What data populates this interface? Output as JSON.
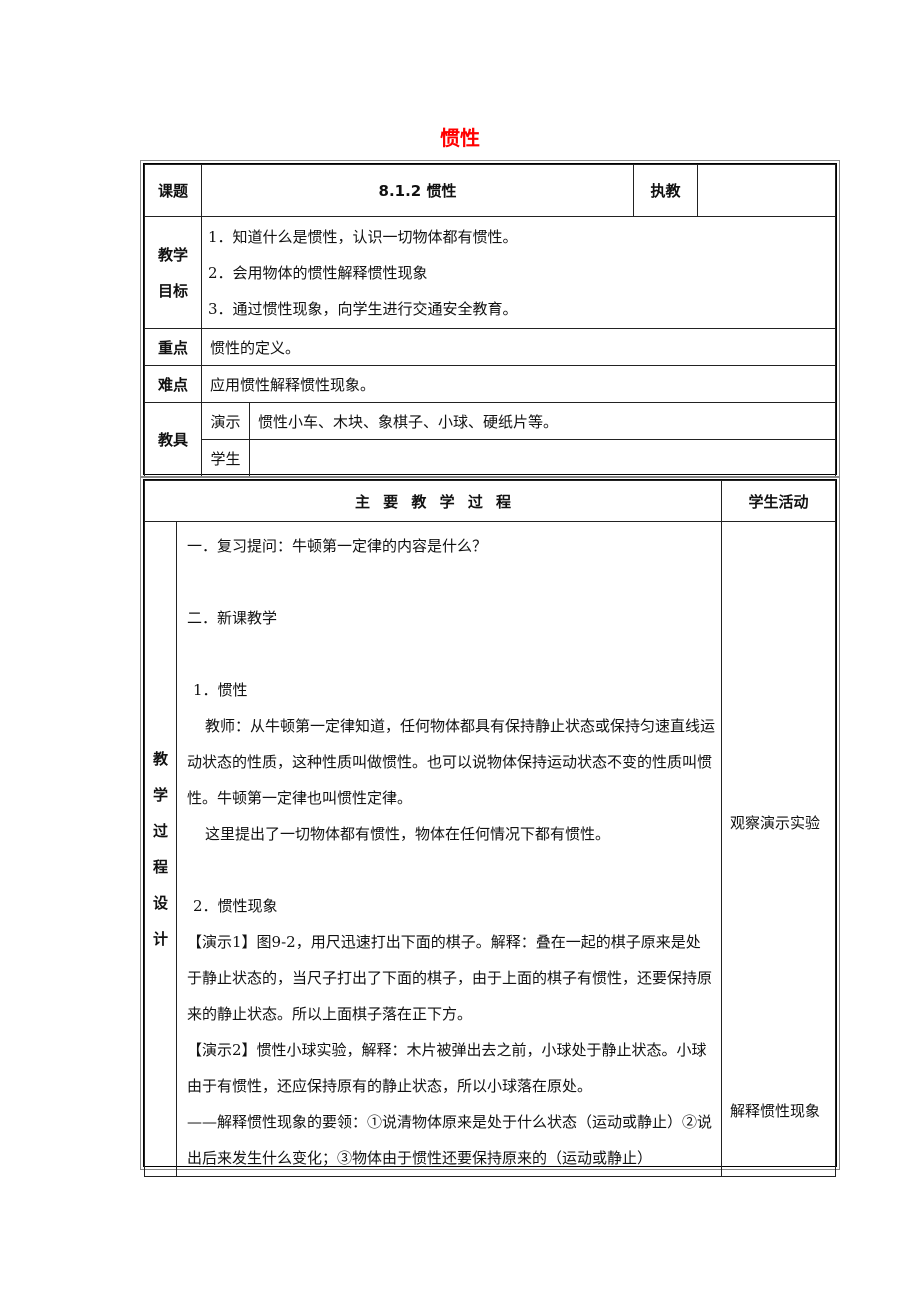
{
  "title": "惯性",
  "header": {
    "topic_label": "课题",
    "topic_value": "8.1.2 惯性",
    "teacher_label": "执教",
    "teacher_value": ""
  },
  "goals": {
    "label_line1": "教学",
    "label_line2": "目标",
    "items": [
      "1．知道什么是惯性，认识一切物体都有惯性。",
      "2．会用物体的惯性解释惯性现象",
      "3．通过惯性现象，向学生进行交通安全教育。"
    ]
  },
  "key_point": {
    "label": "重点",
    "value": "惯性的定义。"
  },
  "difficulty": {
    "label": "难点",
    "value": "应用惯性解释惯性现象。"
  },
  "tools": {
    "label": "教具",
    "demo_label": "演示",
    "demo_value": "惯性小车、木块、象棋子、小球、硬纸片等。",
    "student_label": "学生",
    "student_value": ""
  },
  "process": {
    "header_main": "主 要 教 学 过 程",
    "header_activity": "学生活动",
    "side_label": [
      "教",
      "学",
      "过",
      "程",
      "设",
      "计"
    ],
    "lines": {
      "review": "一．复习提问：牛顿第一定律的内容是什么？",
      "new_lesson": "二．新课教学",
      "sec1_title": "1．惯性",
      "sec1_p1": "教师：从牛顿第一定律知道，任何物体都具有保持静止状态或保持匀速直线运动状态的性质，这种性质叫做惯性。也可以说物体保持运动状态不变的性质叫惯性。牛顿第一定律也叫惯性定律。",
      "sec1_p2": "这里提出了一切物体都有惯性，物体在任何情况下都有惯性。",
      "sec2_title": "2．惯性现象",
      "demo1": "【演示1】图9-2，用尺迅速打出下面的棋子。解释：叠在一起的棋子原来是处于静止状态的，当尺子打出了下面的棋子，由于上面的棋子有惯性，还要保持原来的静止状态。所以上面棋子落在正下方。",
      "demo2": "【演示2】惯性小球实验，解释：木片被弹出去之前，小球处于静止状态。小球由于有惯性，还应保持原有的静止状态，所以小球落在原处。",
      "key_method": "——解释惯性现象的要领：①说清物体原来是处于什么状态（运动或静止）②说出后来发生什么变化；③物体由于惯性还要保持原来的（运动或静止）"
    },
    "activities": {
      "observe": "观察演示实验",
      "explain": "解释惯性现象"
    }
  }
}
